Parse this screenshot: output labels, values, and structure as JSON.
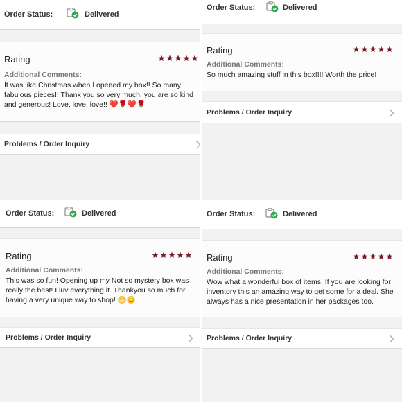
{
  "colors": {
    "star": "#7a1d2a",
    "check": "#34a853",
    "background": "#f2f2f2"
  },
  "icons": {
    "status": "delivered-box-check-icon",
    "star": "star-icon",
    "chevron": "chevron-right-icon"
  },
  "panels": [
    {
      "status_label": "Order Status:",
      "status_value": "Delivered",
      "rating_title": "Rating",
      "stars": 5,
      "comments_heading": "Additional Comments:",
      "comments": "It was like Christmas when I opened my box!! So many fabulous pieces!! Thank you so very much, you are so kind and generous! Love, love, love!! ❤️🌹❤️🌹",
      "inquiry_label": "Problems / Order Inquiry"
    },
    {
      "status_label": "Order Status:",
      "status_value": "Delivered",
      "rating_title": "Rating",
      "stars": 5,
      "comments_heading": "Additional Comments:",
      "comments": "So much amazing stuff in this box!!!! Worth the price!",
      "inquiry_label": "Problems / Order Inquiry"
    },
    {
      "status_label": "Order Status:",
      "status_value": "Delivered",
      "rating_title": "Rating",
      "stars": 5,
      "comments_heading": "Additional Comments:",
      "comments": "This was so fun! Opening up my Not so mystery box was really the best! I luv everything it. Thankyou so much for having a very unique way to shop! 😁😊",
      "inquiry_label": "Problems / Order Inquiry"
    },
    {
      "status_label": "Order Status:",
      "status_value": "Delivered",
      "rating_title": "Rating",
      "stars": 5,
      "comments_heading": "Additional Comments:",
      "comments": "Wow what a wonderful box of items! If you are looking for inventory this an amazing way to get some for a deal. She always has a nice presentation in her packages too.",
      "inquiry_label": "Problems / Order Inquiry"
    }
  ]
}
